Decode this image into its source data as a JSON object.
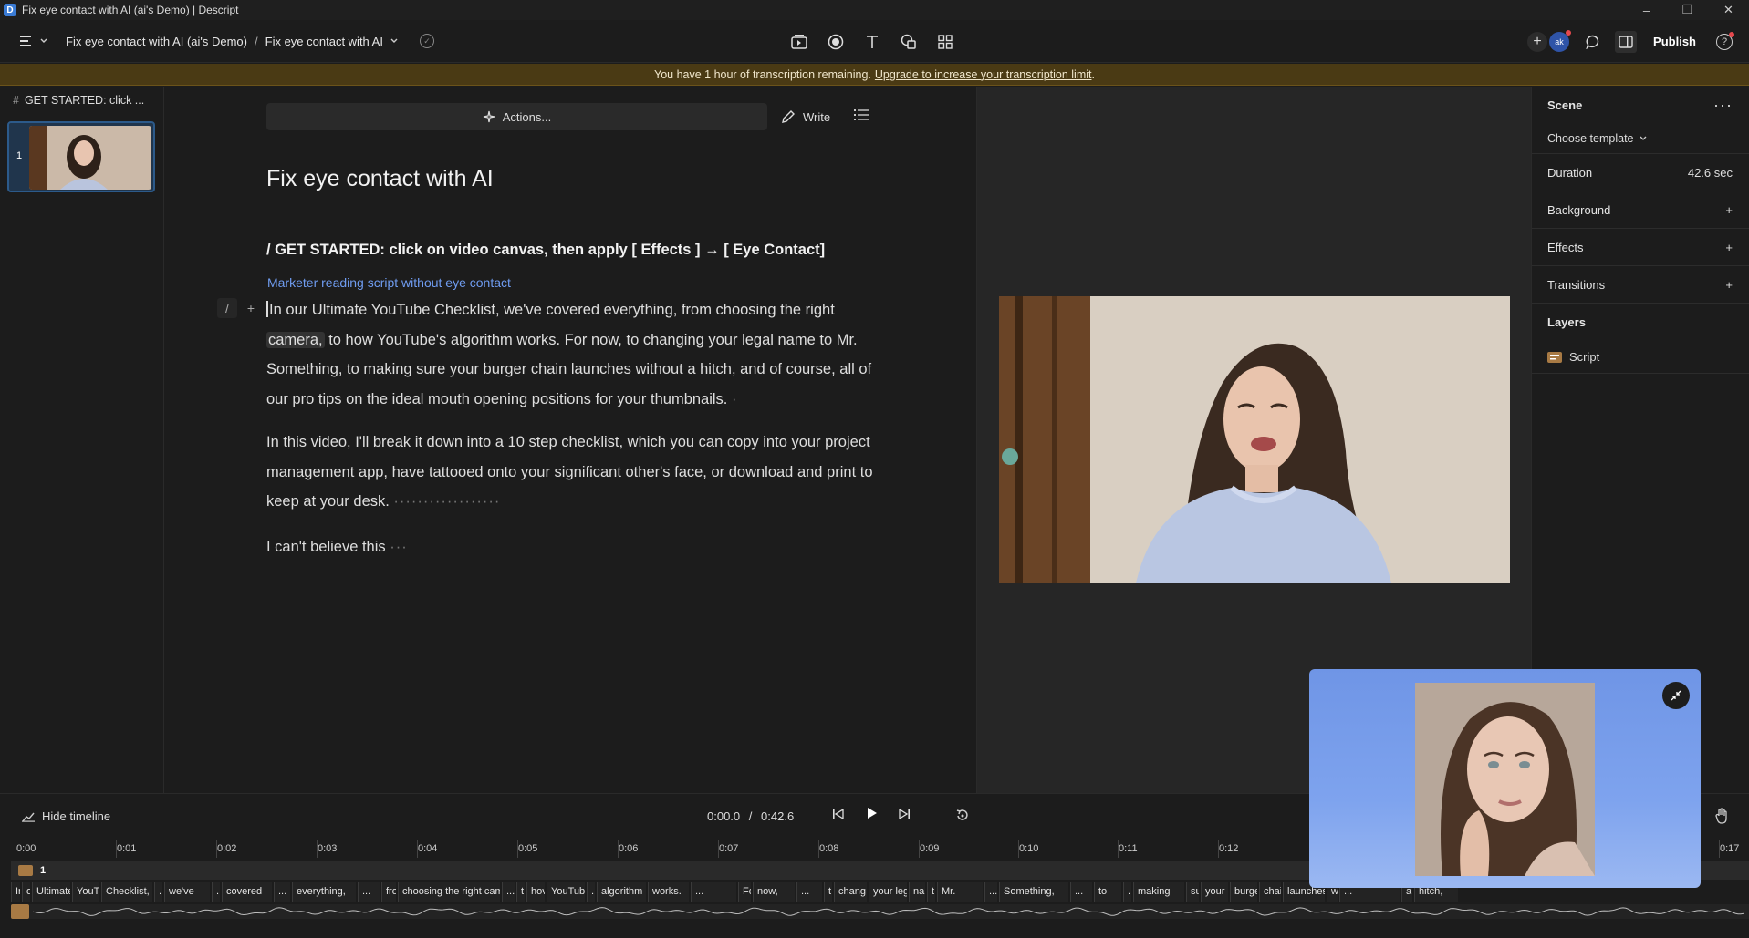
{
  "window": {
    "title": "Fix eye contact with AI (ai's Demo) | Descript",
    "controls": [
      "–",
      "❐",
      "✕"
    ]
  },
  "toolbar": {
    "project": "Fix eye contact with AI (ai's Demo)",
    "separator": "/",
    "composition": "Fix eye contact with AI",
    "avatar_initials": "ak",
    "publish_label": "Publish"
  },
  "banner": {
    "text": "You have 1 hour of transcription remaining.",
    "link": "Upgrade to increase your transcription limit",
    "suffix": "."
  },
  "scenes": {
    "title": "GET STARTED: click ...",
    "number": "1"
  },
  "editor": {
    "actions_label": "Actions...",
    "write_label": "Write",
    "doc_title": "Fix eye contact with AI",
    "get_started": "/ GET STARTED: click on video canvas, then apply [ Effects ] → [ Eye Contact]",
    "speaker": "Marketer reading script without eye contact",
    "p1_first": "In",
    "p1_a": " our Ultimate YouTube Checklist, we've covered everything, from choosing the right ",
    "p1_hl": "camera,",
    "p1_b": " to how YouTube's algorithm works. For now, to changing your legal name to Mr. Something, to making sure your burger chain launches without a hitch, and of course, all of our pro tips on the ideal mouth opening positions for your thumbnails.",
    "p1_gap": "·",
    "p2": "In this video, I'll break it down into a 10 step checklist, which you can copy into your project management app, have tattooed onto your significant other's face, or download and print to keep at your desk.",
    "p2_gap": "··················",
    "p3": "I can't believe this",
    "p3_gap": "···"
  },
  "props": {
    "scene_label": "Scene",
    "choose_template": "Choose template",
    "duration_label": "Duration",
    "duration_value": "42.6 sec",
    "background_label": "Background",
    "effects_label": "Effects",
    "transitions_label": "Transitions",
    "layers_label": "Layers",
    "layer_script": "Script"
  },
  "timeline": {
    "hide_label": "Hide timeline",
    "current_time": "0:00.0",
    "time_sep": "/",
    "total_time": "0:42.6",
    "track_number": "1",
    "ticks": [
      "0:00",
      "0:01",
      "0:02",
      "0:03",
      "0:04",
      "0:05",
      "0:06",
      "0:07",
      "0:08",
      "0:09",
      "0:10",
      "0:11",
      "0:12",
      "0:17"
    ],
    "words": [
      "In",
      "o",
      "Ultimate",
      "YouTu",
      "Checklist,",
      "..",
      "we've",
      "..",
      "covered",
      "...",
      "everything,",
      "...",
      "fro",
      "choosing the right came",
      "...",
      "t",
      "hov",
      "YouTube'",
      "..",
      "algorithm",
      "works.",
      "...",
      "Fo",
      "now,",
      "...",
      "t",
      "chang",
      "your leg",
      "nan",
      "t",
      "Mr.",
      "...",
      "Something,",
      "...",
      "to",
      "..",
      "making",
      "su",
      "your",
      "burge",
      "chai",
      "launches",
      "w",
      "...",
      "a",
      "hitch,"
    ]
  },
  "colors": {
    "accent": "#6f9cf0",
    "banner_bg": "#4a3a14",
    "floating_bg": "#7ea3ee"
  }
}
